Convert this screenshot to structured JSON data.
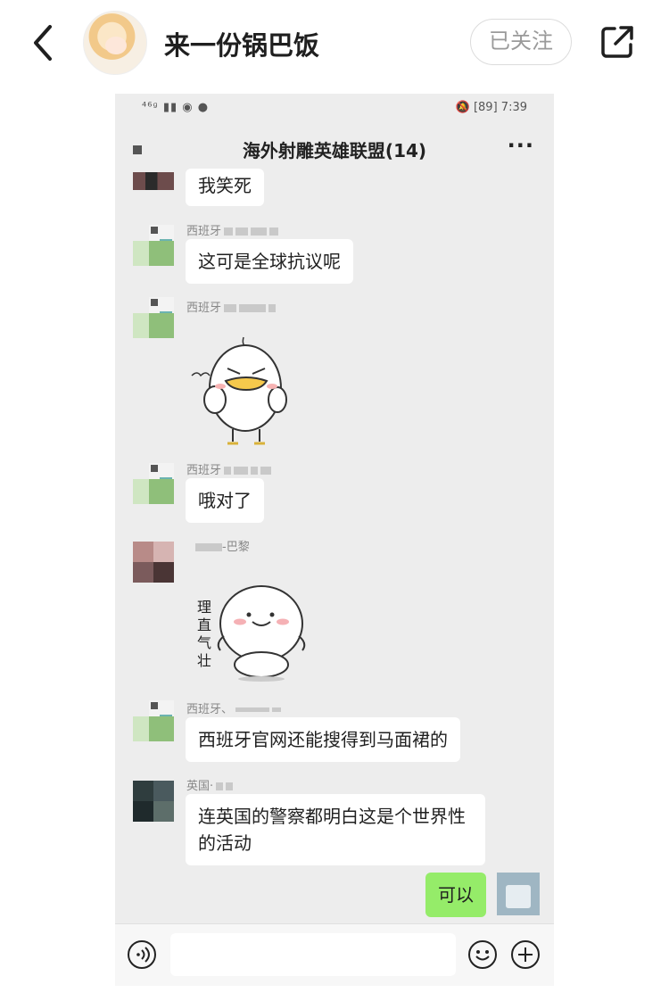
{
  "topbar": {
    "username": "来一份锅巴饭",
    "follow_label": "已关注",
    "icons": [
      "chevron-left-icon",
      "share-icon"
    ]
  },
  "phone": {
    "status_bar": {
      "left": "⁴⁶ᵍ",
      "battery": "89",
      "time": "7:39"
    },
    "chat_title": "海外射雕英雄联盟(14)",
    "messages": [
      {
        "text": "我笑死"
      },
      {
        "sender": "西班牙",
        "text": "这可是全球抗议呢"
      },
      {
        "sender": "西班牙",
        "sticker": "angry-duck"
      },
      {
        "sender": "西班牙",
        "text": "哦对了"
      },
      {
        "sender": "-巴黎",
        "sticker": "confident-blob",
        "sticker_text": [
          "理",
          "直",
          "气",
          "壮"
        ]
      },
      {
        "sender": "西班牙、",
        "text": "西班牙官网还能搜得到马面裙的"
      },
      {
        "sender": "英国·",
        "text": "连英国的警察都明白这是个世界性的活动"
      },
      {
        "self": true,
        "text": "可以"
      }
    ],
    "more_label": "···"
  },
  "colors": {
    "self_bubble": "#95ec69",
    "chat_bg": "#ededed"
  }
}
